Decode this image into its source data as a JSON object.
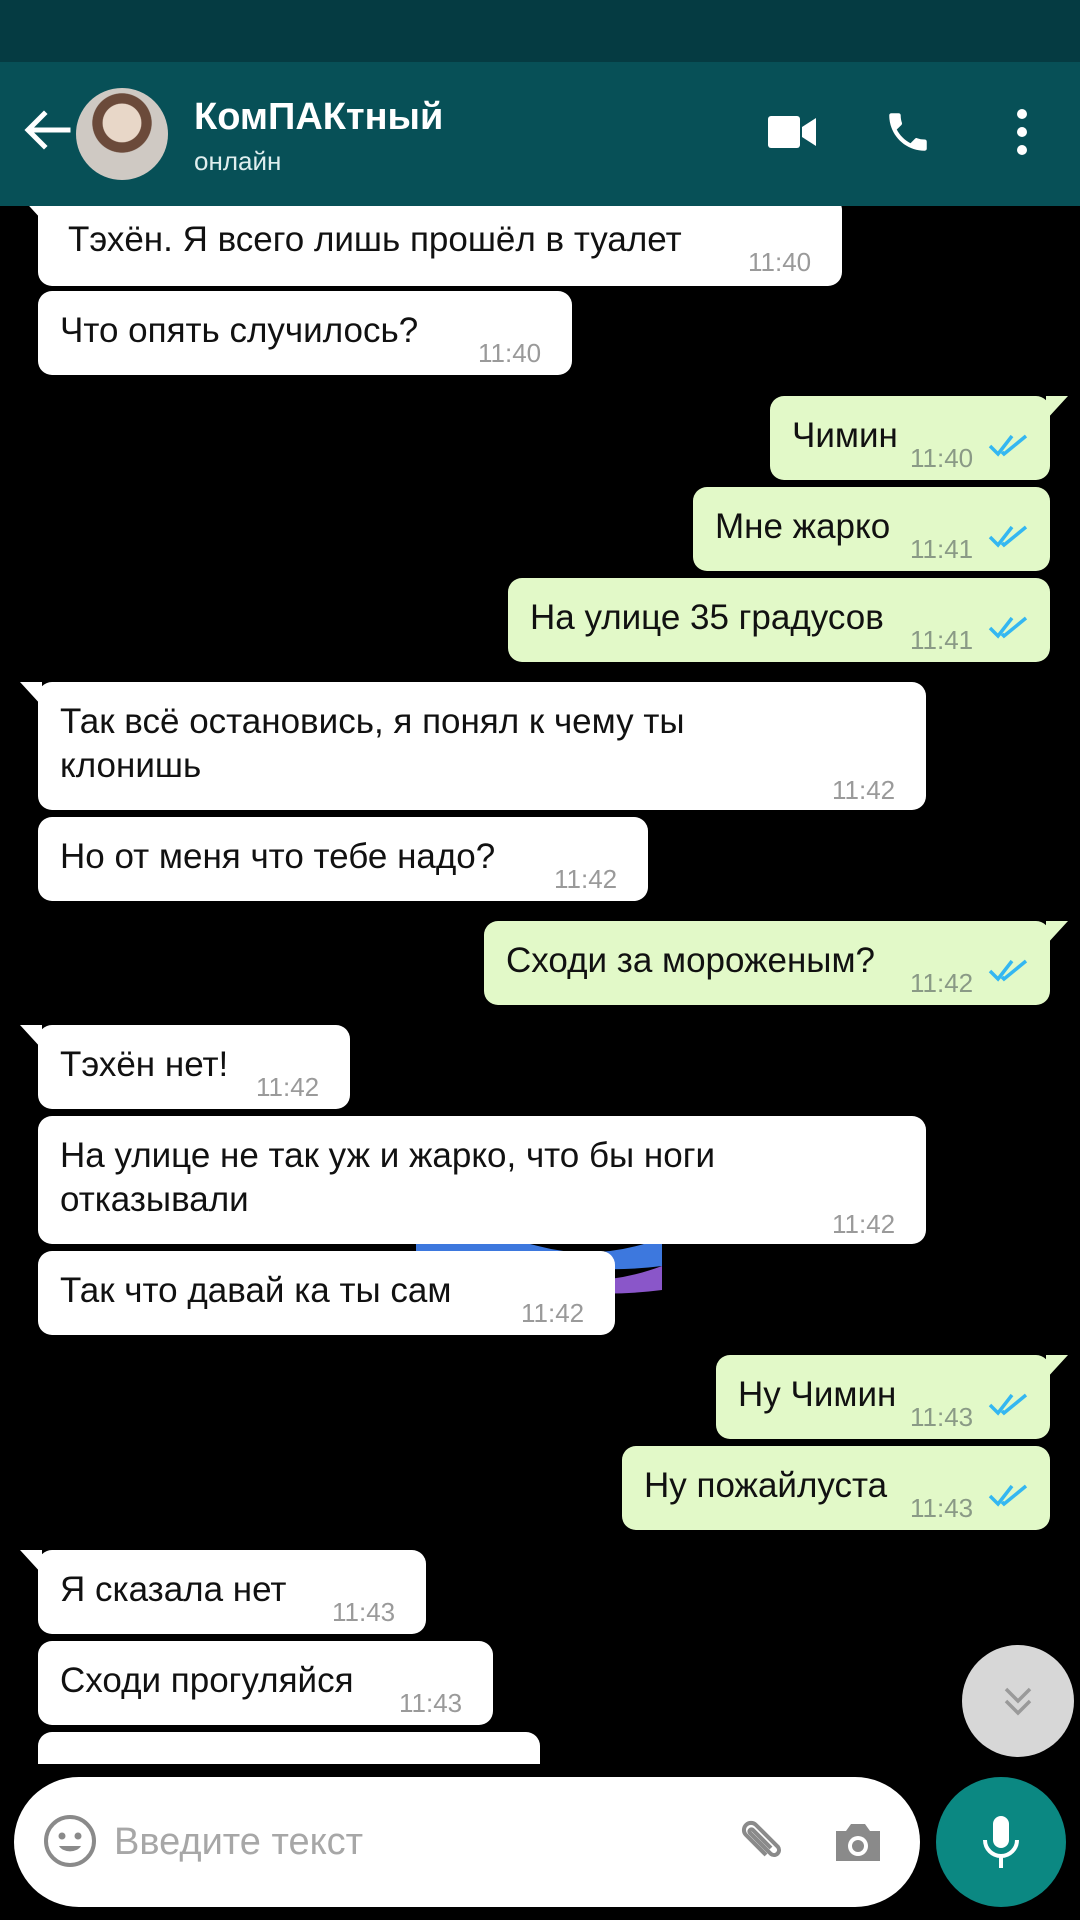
{
  "header": {
    "contact_name": "КомПАКтный",
    "contact_status": "онлайн"
  },
  "messages": [
    {
      "text": "Тэхён. Я всего лишь прошёл в туалет",
      "time": "11:40",
      "direction": "incoming"
    },
    {
      "text": "Что опять случилось?",
      "time": "11:40",
      "direction": "incoming"
    },
    {
      "text": "Чимин",
      "time": "11:40",
      "direction": "outgoing",
      "status": "read"
    },
    {
      "text": "Мне жарко",
      "time": "11:41",
      "direction": "outgoing",
      "status": "read"
    },
    {
      "text": "На улице 35 градусов",
      "time": "11:41",
      "direction": "outgoing",
      "status": "read"
    },
    {
      "text": "Так всё остановись, я понял к чему ты клонишь",
      "time": "11:42",
      "direction": "incoming"
    },
    {
      "text": "Но от меня что тебе надо?",
      "time": "11:42",
      "direction": "incoming"
    },
    {
      "text": "Сходи за мороженым?",
      "time": "11:42",
      "direction": "outgoing",
      "status": "read"
    },
    {
      "text": "Тэхён нет!",
      "time": "11:42",
      "direction": "incoming"
    },
    {
      "text": "На улице не так уж и жарко, что бы ноги отказывали",
      "time": "11:42",
      "direction": "incoming"
    },
    {
      "text": "Так что давай ка ты сам",
      "time": "11:42",
      "direction": "incoming"
    },
    {
      "text": "Ну Чимин",
      "time": "11:43",
      "direction": "outgoing",
      "status": "read"
    },
    {
      "text": "Ну пожайлуста",
      "time": "11:43",
      "direction": "outgoing",
      "status": "read"
    },
    {
      "text": "Я сказала нет",
      "time": "11:43",
      "direction": "incoming"
    },
    {
      "text": "Сходи прогуляйся",
      "time": "11:43",
      "direction": "incoming"
    }
  ],
  "composer": {
    "placeholder": "Введите текст"
  },
  "icons": {
    "back": "arrow-left-icon",
    "video_call": "video-camera-icon",
    "voice_call": "phone-icon",
    "menu": "more-vertical-icon",
    "emoji": "smiley-icon",
    "attach": "paperclip-icon",
    "camera": "camera-icon",
    "mic": "microphone-icon",
    "scroll_down": "double-chevron-down-icon",
    "sticker": "rainbow-flag"
  },
  "colors": {
    "header": "#075057",
    "status_bar": "#053b42",
    "incoming_bubble": "#ffffff",
    "outgoing_bubble": "#e2f9c8",
    "read_ticks": "#34b7f1",
    "accent": "#0b8882"
  }
}
